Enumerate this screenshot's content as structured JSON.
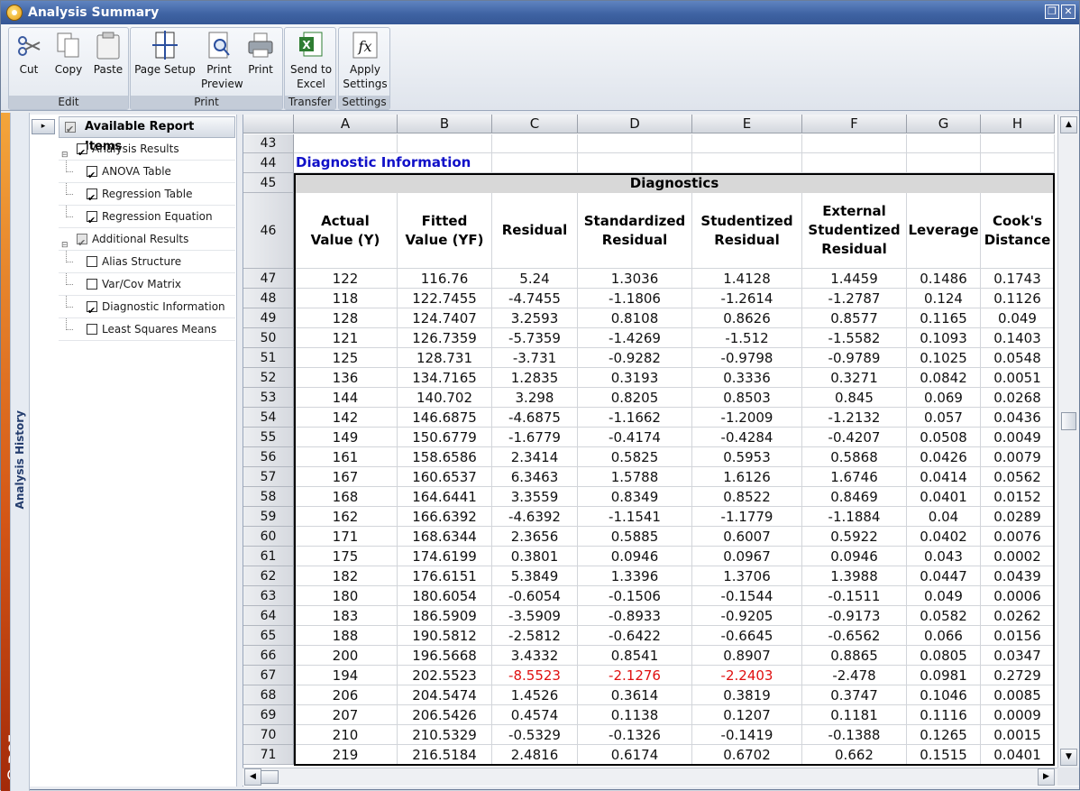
{
  "window": {
    "title": "Analysis Summary"
  },
  "ribbon": {
    "groups": [
      {
        "label": "Edit",
        "buttons": [
          "Cut",
          "Copy",
          "Paste"
        ]
      },
      {
        "label": "Print",
        "buttons": [
          "Page Setup",
          "Print\nPreview",
          "Print"
        ]
      },
      {
        "label": "Transfer",
        "buttons": [
          "Send to\nExcel"
        ]
      },
      {
        "label": "Settings",
        "buttons": [
          "Apply\nSettings"
        ]
      }
    ]
  },
  "sidebar": {
    "history_label": "Analysis History",
    "brand": "DOE++"
  },
  "tree": {
    "header": "Available Report Items",
    "items": [
      {
        "label": "Analysis Results",
        "level": 0,
        "checked": true,
        "expandable": true
      },
      {
        "label": "ANOVA Table",
        "level": 1,
        "checked": true
      },
      {
        "label": "Regression Table",
        "level": 1,
        "checked": true
      },
      {
        "label": "Regression Equation",
        "level": 1,
        "checked": true
      },
      {
        "label": "Additional Results",
        "level": 0,
        "checked": true,
        "expandable": true,
        "grey": true
      },
      {
        "label": "Alias Structure",
        "level": 1,
        "checked": false
      },
      {
        "label": "Var/Cov Matrix",
        "level": 1,
        "checked": false
      },
      {
        "label": "Diagnostic Information",
        "level": 1,
        "checked": true
      },
      {
        "label": "Least Squares Means",
        "level": 1,
        "checked": false
      }
    ]
  },
  "sheet": {
    "columns": [
      "A",
      "B",
      "C",
      "D",
      "E",
      "F",
      "G",
      "H"
    ],
    "section_title": "Diagnostic Information",
    "table_title": "Diagnostics",
    "headers": [
      "Actual\nValue (Y)",
      "Fitted\nValue (YF)",
      "Residual",
      "Standardized\nResidual",
      "Studentized\nResidual",
      "External\nStudentized\nResidual",
      "Leverage",
      "Cook's\nDistance"
    ],
    "header_rows": [
      "43",
      "44",
      "45",
      "46"
    ],
    "rows": [
      {
        "n": "47",
        "v": [
          "122",
          "116.76",
          "5.24",
          "1.3036",
          "1.4128",
          "1.4459",
          "0.1486",
          "0.1743"
        ]
      },
      {
        "n": "48",
        "v": [
          "118",
          "122.7455",
          "-4.7455",
          "-1.1806",
          "-1.2614",
          "-1.2787",
          "0.124",
          "0.1126"
        ]
      },
      {
        "n": "49",
        "v": [
          "128",
          "124.7407",
          "3.2593",
          "0.8108",
          "0.8626",
          "0.8577",
          "0.1165",
          "0.049"
        ]
      },
      {
        "n": "50",
        "v": [
          "121",
          "126.7359",
          "-5.7359",
          "-1.4269",
          "-1.512",
          "-1.5582",
          "0.1093",
          "0.1403"
        ]
      },
      {
        "n": "51",
        "v": [
          "125",
          "128.731",
          "-3.731",
          "-0.9282",
          "-0.9798",
          "-0.9789",
          "0.1025",
          "0.0548"
        ]
      },
      {
        "n": "52",
        "v": [
          "136",
          "134.7165",
          "1.2835",
          "0.3193",
          "0.3336",
          "0.3271",
          "0.0842",
          "0.0051"
        ]
      },
      {
        "n": "53",
        "v": [
          "144",
          "140.702",
          "3.298",
          "0.8205",
          "0.8503",
          "0.845",
          "0.069",
          "0.0268"
        ]
      },
      {
        "n": "54",
        "v": [
          "142",
          "146.6875",
          "-4.6875",
          "-1.1662",
          "-1.2009",
          "-1.2132",
          "0.057",
          "0.0436"
        ]
      },
      {
        "n": "55",
        "v": [
          "149",
          "150.6779",
          "-1.6779",
          "-0.4174",
          "-0.4284",
          "-0.4207",
          "0.0508",
          "0.0049"
        ]
      },
      {
        "n": "56",
        "v": [
          "161",
          "158.6586",
          "2.3414",
          "0.5825",
          "0.5953",
          "0.5868",
          "0.0426",
          "0.0079"
        ]
      },
      {
        "n": "57",
        "v": [
          "167",
          "160.6537",
          "6.3463",
          "1.5788",
          "1.6126",
          "1.6746",
          "0.0414",
          "0.0562"
        ]
      },
      {
        "n": "58",
        "v": [
          "168",
          "164.6441",
          "3.3559",
          "0.8349",
          "0.8522",
          "0.8469",
          "0.0401",
          "0.0152"
        ]
      },
      {
        "n": "59",
        "v": [
          "162",
          "166.6392",
          "-4.6392",
          "-1.1541",
          "-1.1779",
          "-1.1884",
          "0.04",
          "0.0289"
        ]
      },
      {
        "n": "60",
        "v": [
          "171",
          "168.6344",
          "2.3656",
          "0.5885",
          "0.6007",
          "0.5922",
          "0.0402",
          "0.0076"
        ]
      },
      {
        "n": "61",
        "v": [
          "175",
          "174.6199",
          "0.3801",
          "0.0946",
          "0.0967",
          "0.0946",
          "0.043",
          "0.0002"
        ]
      },
      {
        "n": "62",
        "v": [
          "182",
          "176.6151",
          "5.3849",
          "1.3396",
          "1.3706",
          "1.3988",
          "0.0447",
          "0.0439"
        ]
      },
      {
        "n": "63",
        "v": [
          "180",
          "180.6054",
          "-0.6054",
          "-0.1506",
          "-0.1544",
          "-0.1511",
          "0.049",
          "0.0006"
        ]
      },
      {
        "n": "64",
        "v": [
          "183",
          "186.5909",
          "-3.5909",
          "-0.8933",
          "-0.9205",
          "-0.9173",
          "0.0582",
          "0.0262"
        ]
      },
      {
        "n": "65",
        "v": [
          "188",
          "190.5812",
          "-2.5812",
          "-0.6422",
          "-0.6645",
          "-0.6562",
          "0.066",
          "0.0156"
        ]
      },
      {
        "n": "66",
        "v": [
          "200",
          "196.5668",
          "3.4332",
          "0.8541",
          "0.8907",
          "0.8865",
          "0.0805",
          "0.0347"
        ]
      },
      {
        "n": "67",
        "v": [
          "194",
          "202.5523",
          "-8.5523",
          "-2.1276",
          "-2.2403",
          "-2.478",
          "0.0981",
          "0.2729"
        ],
        "red": [
          2,
          3,
          4
        ]
      },
      {
        "n": "68",
        "v": [
          "206",
          "204.5474",
          "1.4526",
          "0.3614",
          "0.3819",
          "0.3747",
          "0.1046",
          "0.0085"
        ]
      },
      {
        "n": "69",
        "v": [
          "207",
          "206.5426",
          "0.4574",
          "0.1138",
          "0.1207",
          "0.1181",
          "0.1116",
          "0.0009"
        ]
      },
      {
        "n": "70",
        "v": [
          "210",
          "210.5329",
          "-0.5329",
          "-0.1326",
          "-0.1419",
          "-0.1388",
          "0.1265",
          "0.0015"
        ]
      },
      {
        "n": "71",
        "v": [
          "219",
          "216.5184",
          "2.4816",
          "0.6174",
          "0.6702",
          "0.662",
          "0.1515",
          "0.0401"
        ]
      }
    ],
    "highlight_color": "#e01010",
    "title_color": "#1010c8"
  }
}
